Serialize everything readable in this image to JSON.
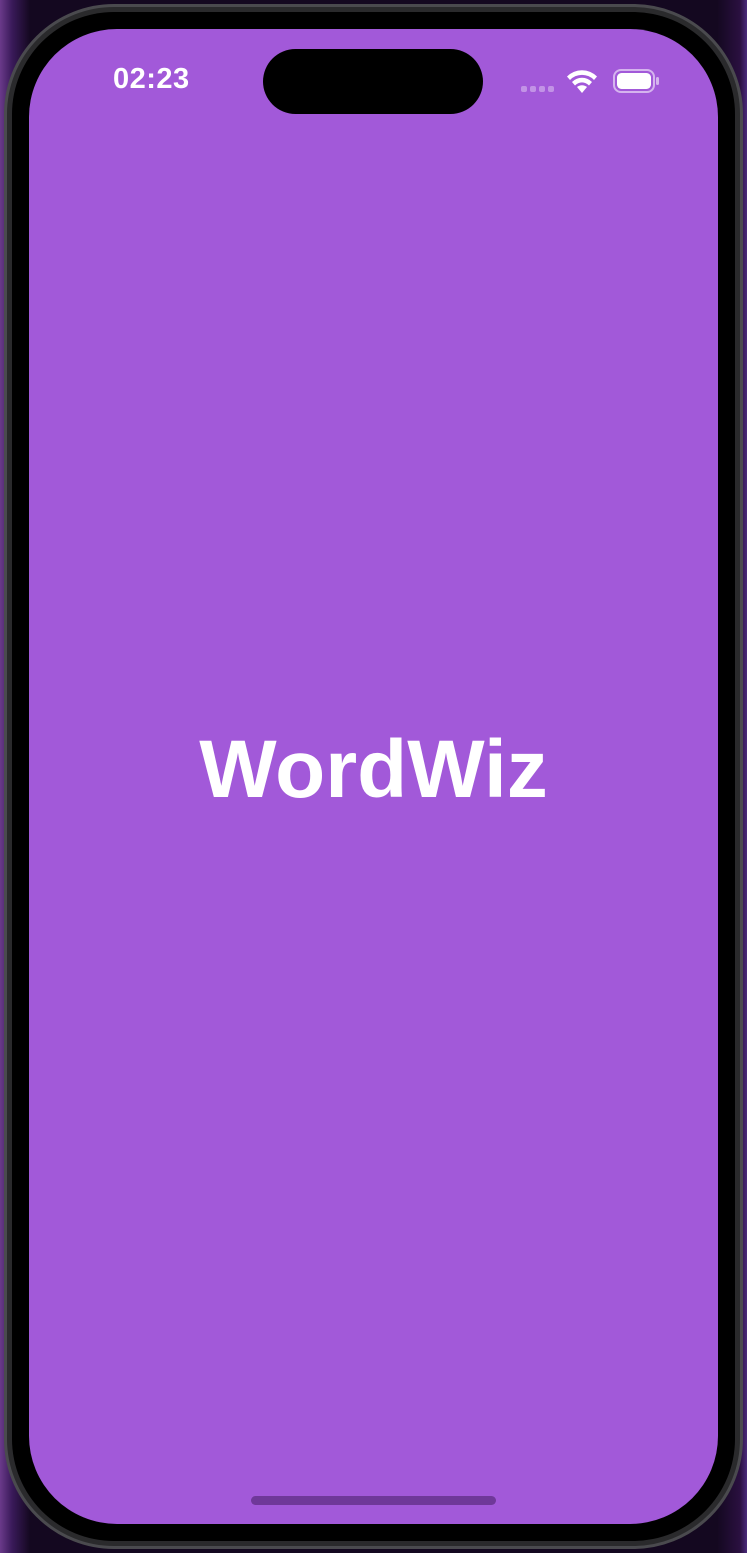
{
  "status_bar": {
    "time": "02:23",
    "icons": [
      "cellular-signal-icon",
      "wifi-icon",
      "battery-icon"
    ]
  },
  "app": {
    "title": "WordWiz",
    "background_color": "#a259d9",
    "text_color": "#ffffff"
  }
}
